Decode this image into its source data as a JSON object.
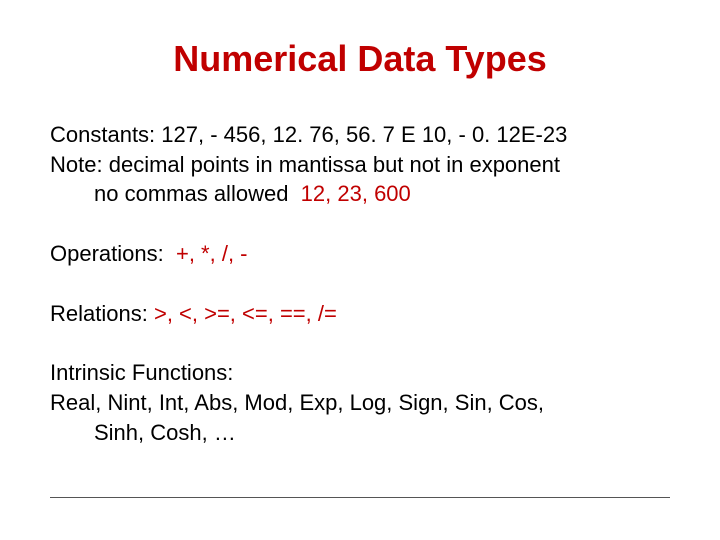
{
  "title": "Numerical Data Types",
  "constants": {
    "label": "Constants:",
    "values": "127, - 456, 12. 76, 56. 7 E 10, - 0. 12E-23",
    "note_label": "Note:",
    "note_line1": "decimal points in mantissa but not in exponent",
    "note_line2_pre": "no commas allowed",
    "note_line2_red": "12, 23, 600"
  },
  "operations": {
    "label": "Operations:",
    "values": "+, *, /, -"
  },
  "relations": {
    "label": "Relations:",
    "values": ">, <, >=, <=, ==, /="
  },
  "intrinsic": {
    "label": "Intrinsic Functions:",
    "list_line1": "Real, Nint, Int, Abs, Mod, Exp, Log, Sign, Sin, Cos,",
    "list_line2": "Sinh, Cosh, …"
  }
}
